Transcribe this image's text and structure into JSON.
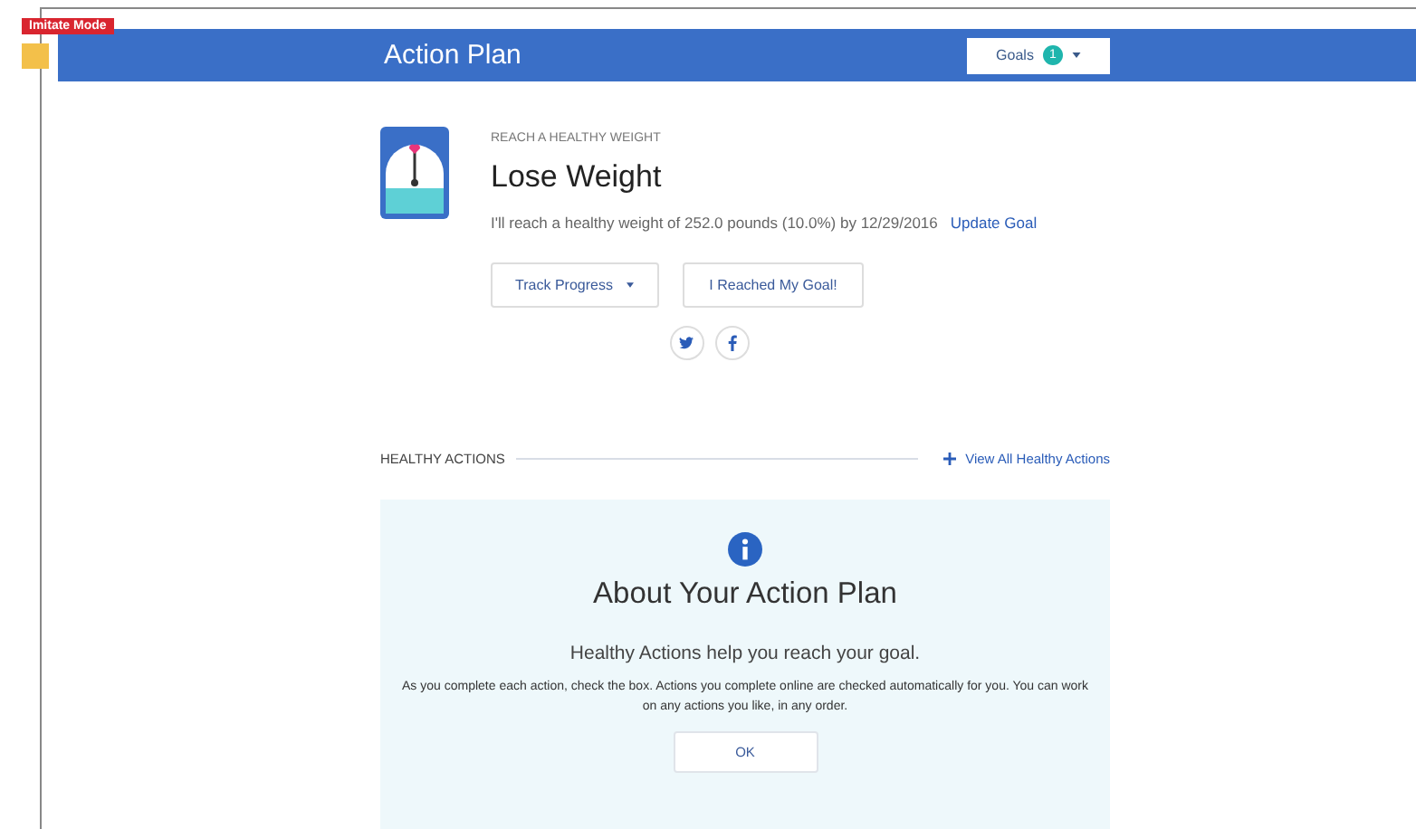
{
  "mode_badge": "Imitate Mode",
  "header": {
    "title": "Action Plan",
    "goals_menu": {
      "label": "Goals",
      "count": "1"
    }
  },
  "goal": {
    "category": "REACH A HEALTHY WEIGHT",
    "title": "Lose Weight",
    "description": "I'll reach a healthy weight of 252.0 pounds (10.0%) by 12/29/2016",
    "link": "Update Goal",
    "buttons": [
      {
        "label": "Track Progress",
        "kind": "dropdown"
      },
      {
        "label": "I Reached My Goal!",
        "kind": "plain"
      }
    ],
    "share": [
      {
        "kind": "twitter"
      },
      {
        "kind": "facebook"
      }
    ]
  },
  "healthy_actions": {
    "title": "HEALTHY ACTIONS",
    "link": "View All Healthy Actions",
    "info_card": {
      "title": "About Your Action Plan",
      "subtitle": "Healthy Actions help you reach your goal.",
      "body": "As you complete each action, check the box. Actions you complete online are checked automatically for you. You can work on any actions you like, in any order.",
      "button": "OK"
    }
  }
}
